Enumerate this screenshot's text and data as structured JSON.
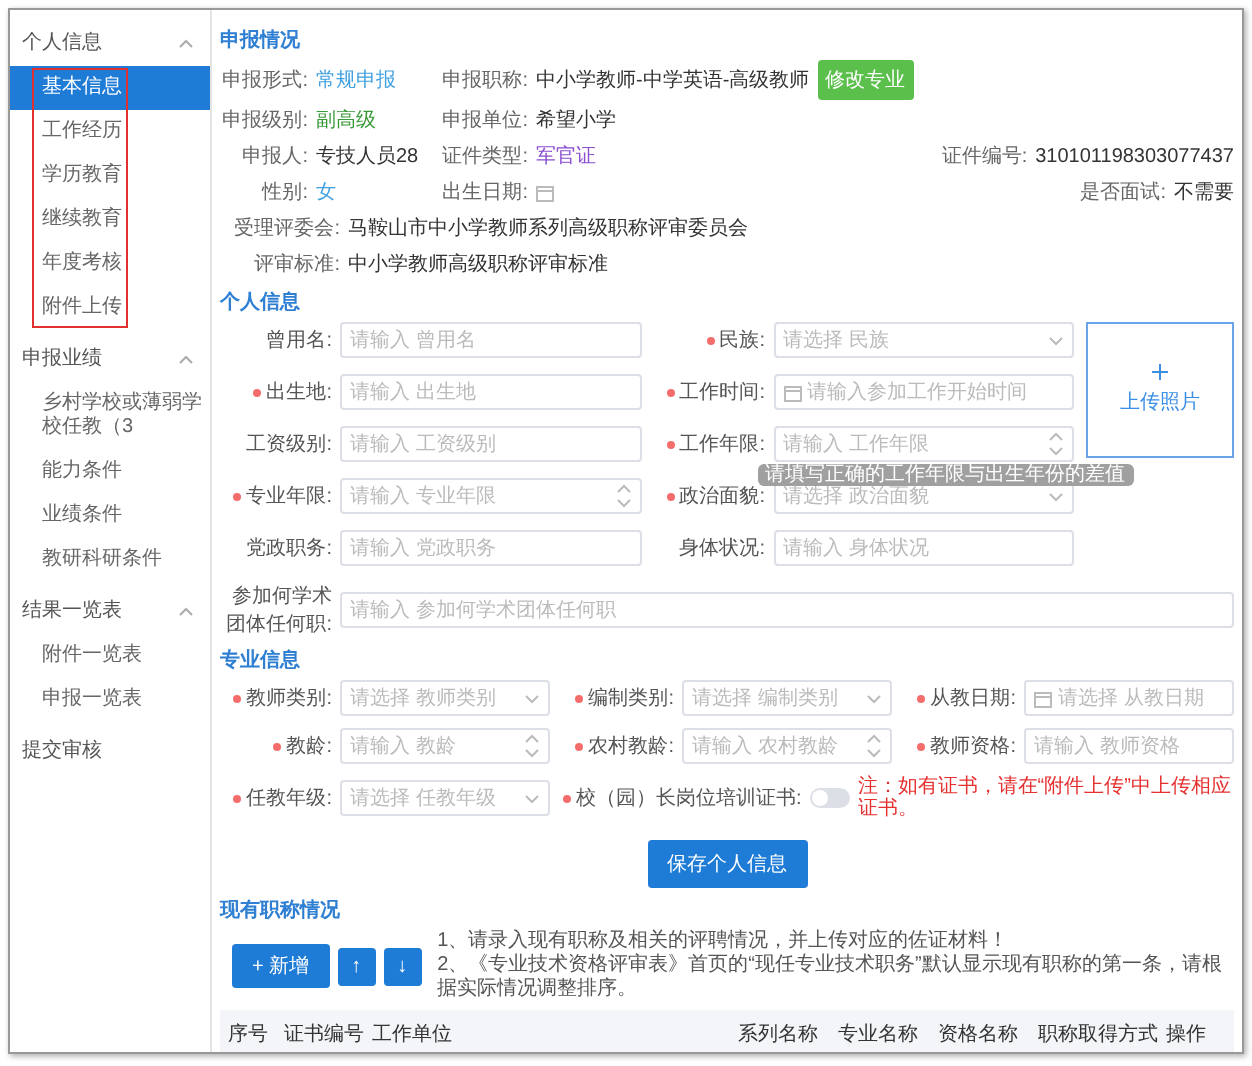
{
  "sidebar": {
    "groups": [
      {
        "label": "个人信息",
        "expanded": true,
        "highlighted": true,
        "items": [
          {
            "label": "基本信息",
            "selected": true
          },
          {
            "label": "工作经历",
            "selected": false
          },
          {
            "label": "学历教育",
            "selected": false
          },
          {
            "label": "继续教育",
            "selected": false
          },
          {
            "label": "年度考核",
            "selected": false
          },
          {
            "label": "附件上传",
            "selected": false
          }
        ]
      },
      {
        "label": "申报业绩",
        "expanded": true,
        "highlighted": false,
        "items": [
          {
            "label": "乡村学校或薄弱学校任教（3",
            "selected": false
          },
          {
            "label": "能力条件",
            "selected": false
          },
          {
            "label": "业绩条件",
            "selected": false
          },
          {
            "label": "教研科研条件",
            "selected": false
          }
        ]
      },
      {
        "label": "结果一览表",
        "expanded": true,
        "highlighted": false,
        "items": [
          {
            "label": "附件一览表",
            "selected": false
          },
          {
            "label": "申报一览表",
            "selected": false
          }
        ]
      },
      {
        "label": "提交审核"
      }
    ]
  },
  "declaration": {
    "title": "申报情况",
    "rows": [
      [
        {
          "label": "申报形式:",
          "value": "常规申报",
          "color": "#3fa0e0"
        },
        {
          "label": "申报职称:",
          "value": "中小学教师-中学英语-高级教师",
          "action": "修改专业"
        }
      ],
      [
        {
          "label": "申报级别:",
          "value": "副高级",
          "color": "#3a9a3a"
        },
        {
          "label": "申报单位:",
          "value": "希望小学"
        }
      ],
      [
        {
          "label": "申报人:",
          "value": "专技人员28"
        },
        {
          "label": "证件类型:",
          "value": "军官证",
          "color": "#8a4fd0"
        },
        {
          "label": "证件编号:",
          "value": "310101198303077437"
        }
      ],
      [
        {
          "label": "性别:",
          "value": "女",
          "color": "#3fa0e0"
        },
        {
          "label": "出生日期:",
          "kind": "date"
        },
        {
          "label": "是否面试:",
          "value": "不需要"
        }
      ],
      [
        {
          "label": "受理评委会:",
          "value": "马鞍山市中小学教师系列高级职称评审委员会"
        }
      ],
      [
        {
          "label": "评审标准:",
          "value": "中小学教师高级职称评审标准"
        }
      ]
    ]
  },
  "personal": {
    "title": "个人信息",
    "photo_label": "上传照片",
    "fields": [
      {
        "label": "曾用名:",
        "required": false,
        "kind": "input",
        "placeholder": "请输入 曾用名"
      },
      {
        "label": "民族:",
        "required": true,
        "kind": "select",
        "placeholder": "请选择 民族"
      },
      {
        "label": "出生地:",
        "required": true,
        "kind": "input",
        "placeholder": "请输入 出生地"
      },
      {
        "label": "工作时间:",
        "required": true,
        "kind": "date",
        "placeholder": "请输入参加工作开始时间"
      },
      {
        "label": "工资级别:",
        "required": false,
        "kind": "input",
        "placeholder": "请输入 工资级别"
      },
      {
        "label": "工作年限:",
        "required": true,
        "kind": "number",
        "placeholder": "请输入 工作年限",
        "tooltip": "请填写正确的工作年限与出生年份的差值"
      },
      {
        "label": "专业年限:",
        "required": true,
        "kind": "number",
        "placeholder": "请输入 专业年限"
      },
      {
        "label": "政治面貌:",
        "required": true,
        "kind": "select",
        "placeholder": "请选择 政治面貌"
      },
      {
        "label": "党政职务:",
        "required": false,
        "kind": "input",
        "placeholder": "请输入 党政职务"
      },
      {
        "label": "身体状况:",
        "required": false,
        "kind": "input",
        "placeholder": "请输入 身体状况"
      },
      {
        "label": "参加何学术团体任何职:",
        "required": false,
        "kind": "wide",
        "placeholder": "请输入 参加何学术团体任何职"
      }
    ]
  },
  "professional": {
    "title": "专业信息",
    "fields": [
      {
        "label": "教师类别:",
        "required": true,
        "kind": "select",
        "placeholder": "请选择 教师类别"
      },
      {
        "label": "编制类别:",
        "required": true,
        "kind": "select",
        "placeholder": "请选择 编制类别"
      },
      {
        "label": "从教日期:",
        "required": true,
        "kind": "date",
        "placeholder": "请选择 从教日期"
      },
      {
        "label": "教龄:",
        "required": true,
        "kind": "number",
        "placeholder": "请输入 教龄"
      },
      {
        "label": "农村教龄:",
        "required": true,
        "kind": "number",
        "placeholder": "请输入 农村教龄"
      },
      {
        "label": "教师资格:",
        "required": true,
        "kind": "input",
        "placeholder": "请输入 教师资格"
      },
      {
        "label": "任教年级:",
        "required": true,
        "kind": "select",
        "placeholder": "请选择 任教年级"
      }
    ],
    "certificate": {
      "label": "校（园）长岗位培训证书:",
      "required": true,
      "on": false,
      "note": "注：如有证书，请在“附件上传”中上传相应证书。"
    }
  },
  "save_button": "保存个人信息",
  "titles": {
    "title": "现有职称情况",
    "add_button": "+ 新增",
    "up_button": "↑",
    "down_button": "↓",
    "notes": [
      "1、请录入现有职称及相关的评聘情况，并上传对应的佐证材料！",
      "2、《专业技术资格评审表》首页的“现任专业技术职务”默认显示现有职称的第一条，请根据实际情况调整排序。"
    ],
    "columns": [
      "序号",
      "证书编号",
      "工作单位",
      "系列名称",
      "专业名称",
      "资格名称",
      "职称取得方式",
      "操作"
    ]
  }
}
